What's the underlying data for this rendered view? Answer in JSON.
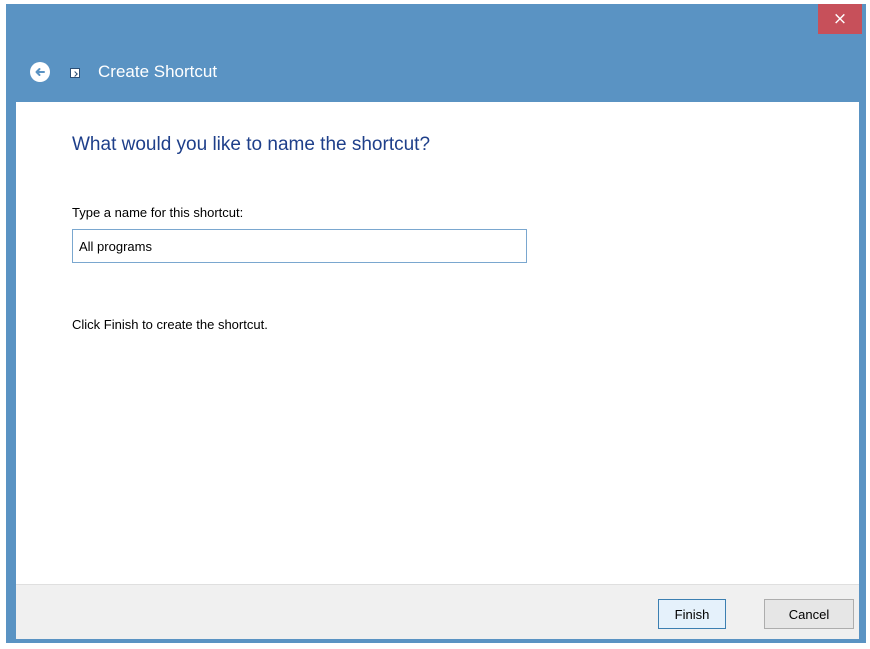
{
  "window": {
    "title": "Create Shortcut",
    "close_symbol": "×"
  },
  "icons": {
    "back": "back-arrow-icon",
    "app": "shortcut-icon",
    "close": "close-icon"
  },
  "main": {
    "heading": "What would you like to name the shortcut?",
    "name_label": "Type a name for this shortcut:",
    "name_value": "All programs",
    "hint": "Click Finish to create the shortcut."
  },
  "footer": {
    "finish_label": "Finish",
    "cancel_label": "Cancel"
  },
  "colors": {
    "title_bar": "#5a93c3",
    "close_button": "#c7505a",
    "heading": "#1e3f8a"
  }
}
